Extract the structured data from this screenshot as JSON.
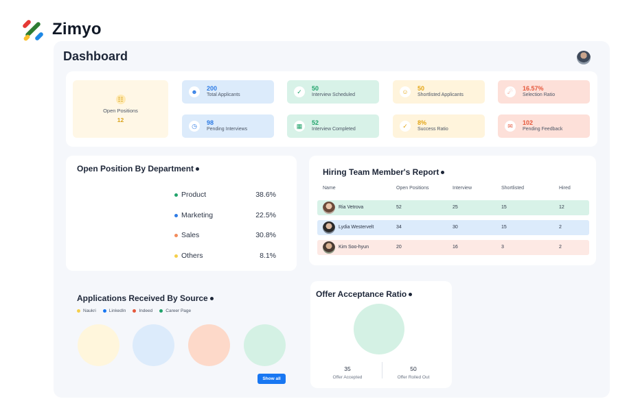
{
  "brand": {
    "name": "Zimyo"
  },
  "page": {
    "title": "Dashboard"
  },
  "stats": {
    "open_positions": {
      "label": "Open Positions",
      "value": "12"
    },
    "tiles": [
      {
        "value": "200",
        "label": "Total Applicants",
        "color": "#2d7be5",
        "icon": "users-icon"
      },
      {
        "value": "50",
        "label": "Interview Scheduled",
        "color": "#21a36b",
        "icon": "calendar-check-icon"
      },
      {
        "value": "50",
        "label": "Shortlisted Applicants",
        "color": "#e3a516",
        "icon": "user-icon"
      },
      {
        "value": "16.57%",
        "label": "Selection Ratio",
        "color": "#e5583c",
        "icon": "user-ratio-icon"
      },
      {
        "value": "98",
        "label": "Pending Interviews",
        "color": "#2d7be5",
        "icon": "clock-icon"
      },
      {
        "value": "52",
        "label": "Interview Completed",
        "color": "#21a36b",
        "icon": "calendar-icon"
      },
      {
        "value": "8%",
        "label": "Success Ratio",
        "color": "#e3a516",
        "icon": "check-icon"
      },
      {
        "value": "102",
        "label": "Pending Feedback",
        "color": "#e5583c",
        "icon": "feedback-icon"
      }
    ]
  },
  "department": {
    "title": "Open Position By Department",
    "items": [
      {
        "name": "Product",
        "pct": "38.6%",
        "color": "#21a36b"
      },
      {
        "name": "Marketing",
        "pct": "22.5%",
        "color": "#2d7be5"
      },
      {
        "name": "Sales",
        "pct": "30.8%",
        "color": "#f28b5b"
      },
      {
        "name": "Others",
        "pct": "8.1%",
        "color": "#f5cf4b"
      }
    ]
  },
  "hiring": {
    "title": "Hiring Team Member's Report",
    "columns": [
      "Name",
      "Open Positions",
      "Interview",
      "Shortlisted",
      "Hired"
    ],
    "rows": [
      {
        "name": "Ria Vetrova",
        "open": "52",
        "interview": "25",
        "shortlisted": "15",
        "hired": "12",
        "bg": "#d8f2e8"
      },
      {
        "name": "Lydia Westervelt",
        "open": "34",
        "interview": "30",
        "shortlisted": "15",
        "hired": "2",
        "bg": "#dcebfb"
      },
      {
        "name": "Kim Soo-hyun",
        "open": "20",
        "interview": "16",
        "shortlisted": "3",
        "hired": "2",
        "bg": "#fde9e4"
      }
    ]
  },
  "applications": {
    "title": "Applications Received By Source",
    "sources": [
      {
        "name": "Naukri",
        "color": "#f5cf4b",
        "fill": "#fff6dc"
      },
      {
        "name": "LinkedIn",
        "color": "#1877f2",
        "fill": "#dcebfb"
      },
      {
        "name": "Indeed",
        "color": "#e5583c",
        "fill": "#fdd9c9"
      },
      {
        "name": "Career Page",
        "color": "#21a36b",
        "fill": "#d4f1e4"
      }
    ],
    "show_all_label": "Show all"
  },
  "offer": {
    "title": "Offer Acceptance Ratio",
    "accepted": {
      "value": "35",
      "label": "Offer Accepted"
    },
    "rolled_out": {
      "value": "50",
      "label": "Offer Rolled Out"
    }
  }
}
